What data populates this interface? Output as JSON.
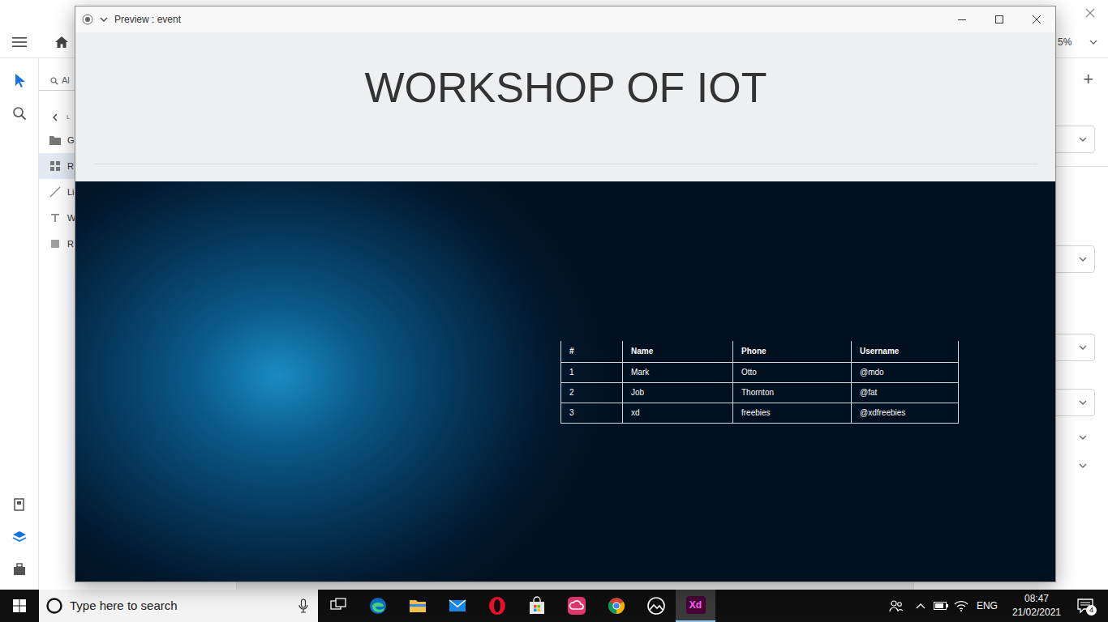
{
  "xd": {
    "tools": [
      {
        "kind": "select",
        "selected": true
      },
      {
        "kind": "search",
        "selected": false
      }
    ],
    "bottom_tools": [
      {
        "kind": "assets",
        "selected": false
      },
      {
        "kind": "layers",
        "selected": true
      },
      {
        "kind": "plugins",
        "selected": false
      }
    ],
    "layers": {
      "search": {
        "placeholder": "Al"
      },
      "breadcrumb": "L",
      "items": [
        {
          "label": "G",
          "kind": "group",
          "selected": false
        },
        {
          "label": "R",
          "kind": "repeat-grid",
          "selected": true
        },
        {
          "label": "Li",
          "kind": "line",
          "selected": false
        },
        {
          "label": "W",
          "kind": "text",
          "selected": false
        },
        {
          "label": "R",
          "kind": "rectangle",
          "selected": false
        }
      ]
    },
    "zoom": "5%",
    "add": "+"
  },
  "window": {
    "title": "Preview : event"
  },
  "page": {
    "heading": "WORKSHOP OF IOT",
    "table": {
      "columns": [
        "#",
        "Name",
        "Phone",
        "Username"
      ],
      "rows": [
        [
          "1",
          "Mark",
          "Otto",
          "@mdo"
        ],
        [
          "2",
          "Job",
          "Thornton",
          "@fat"
        ],
        [
          "3",
          "xd",
          "freebies",
          "@xdfreebies"
        ]
      ]
    }
  },
  "taskbar": {
    "search": {
      "placeholder": "Type here to search"
    },
    "apps": [
      {
        "kind": "task-view",
        "selected": false
      },
      {
        "kind": "edge",
        "selected": false
      },
      {
        "kind": "explorer",
        "selected": false
      },
      {
        "kind": "mail",
        "selected": false
      },
      {
        "kind": "opera",
        "selected": false
      },
      {
        "kind": "store",
        "selected": false
      },
      {
        "kind": "creative-cloud",
        "selected": false
      },
      {
        "kind": "chrome",
        "selected": false
      },
      {
        "kind": "photos",
        "selected": false
      },
      {
        "kind": "xd",
        "selected": true,
        "label": "Xd"
      }
    ],
    "tray": {
      "language": "ENG",
      "time": "08:47",
      "date": "21/02/2021",
      "notifications": "4"
    }
  }
}
